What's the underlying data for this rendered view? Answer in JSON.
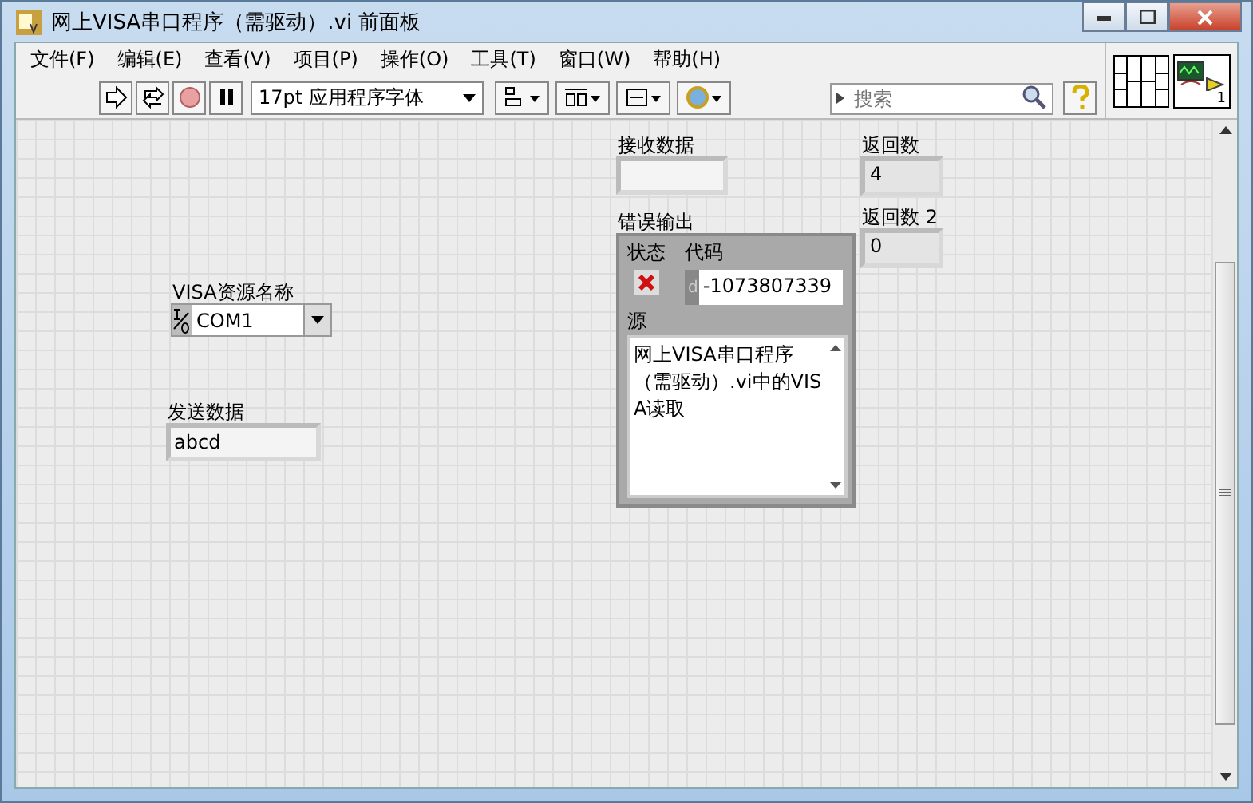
{
  "window": {
    "title": "网上VISA串口程序（需驱动）.vi 前面板"
  },
  "menu": [
    "文件(F)",
    "编辑(E)",
    "查看(V)",
    "项目(P)",
    "操作(O)",
    "工具(T)",
    "窗口(W)",
    "帮助(H)"
  ],
  "toolbar": {
    "font": "17pt 应用程序字体",
    "search_placeholder": "搜索",
    "connector_label": "1"
  },
  "controls": [
    {
      "kind": "string",
      "label": "接收数据"
    },
    {
      "kind": "numeric",
      "label": "返回数",
      "value": "4"
    },
    {
      "kind": "error",
      "label": "错误输出",
      "status_label": "状态",
      "status": true,
      "code_label": "代码",
      "code_prefix": "d",
      "code": "-1073807339",
      "source_label": "源",
      "source": "网上VISA串口程序（需驱动）.vi中的VISA读取"
    },
    {
      "kind": "numeric",
      "label": "返回数 2",
      "value": "0"
    },
    {
      "kind": "visa",
      "label": "VISA资源名称",
      "value": "COM1"
    },
    {
      "kind": "string",
      "label": "发送数据",
      "value": "abcd"
    }
  ]
}
